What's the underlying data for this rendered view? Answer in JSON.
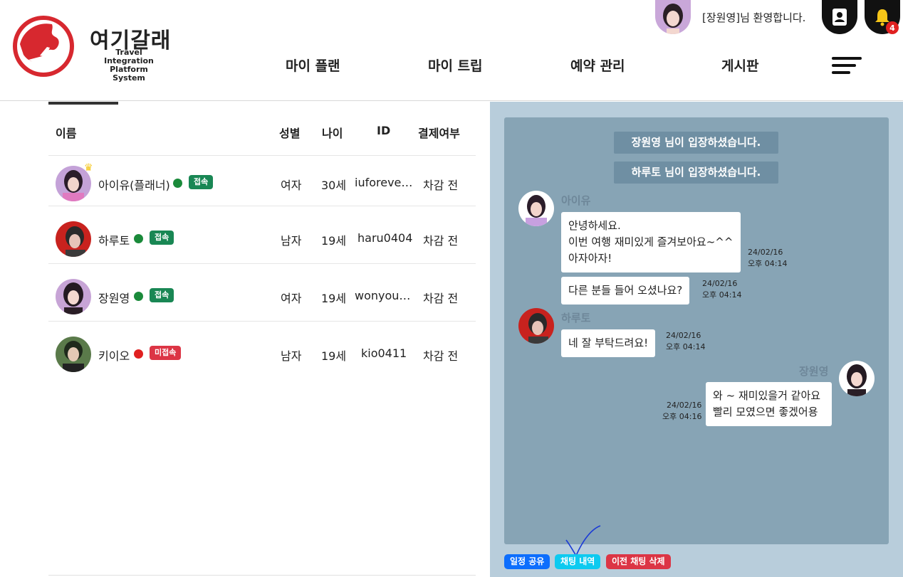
{
  "header": {
    "brand_name": "여기갈래",
    "brand_subtitle_line1": "Travel Integration",
    "brand_subtitle_line2": "Platform System",
    "welcome_text": "[장원영]님 환영합니다.",
    "notification_count": "4",
    "nav": [
      "마이 플랜",
      "마이 트립",
      "예약 관리",
      "게시판"
    ]
  },
  "table": {
    "headers": {
      "name": "이름",
      "gender": "성별",
      "age": "나이",
      "id": "ID",
      "payment": "결제여부"
    },
    "rows": [
      {
        "name": "아이유(플래너)",
        "status": "접속",
        "gender": "여자",
        "age": "30세",
        "id": "iuforeve…",
        "payment": "차감 전"
      },
      {
        "name": "하루토",
        "status": "접속",
        "gender": "남자",
        "age": "19세",
        "id": "haru0404",
        "payment": "차감 전"
      },
      {
        "name": "장원영",
        "status": "접속",
        "gender": "여자",
        "age": "19세",
        "id": "wonyou…",
        "payment": "차감 전"
      },
      {
        "name": "키이오",
        "status": "미접속",
        "gender": "남자",
        "age": "19세",
        "id": "kio0411",
        "payment": "차감 전"
      }
    ]
  },
  "chat": {
    "system_messages": [
      "장원영 님이 입장하셨습니다.",
      "하루토 님이 입장하셨습니다."
    ],
    "messages": [
      {
        "sender": "아이유",
        "lines": [
          "안녕하세요.",
          "이번 여행 재미있게 즐겨보아요~^^",
          "아자아자!"
        ],
        "date": "24/02/16",
        "time": "오후 04:14"
      },
      {
        "sender": "",
        "lines": [
          "다른 분들 들어 오셨나요?"
        ],
        "date": "24/02/16",
        "time": "오후 04:14"
      },
      {
        "sender": "하루토",
        "lines": [
          "네 잘 부탁드려요!"
        ],
        "date": "24/02/16",
        "time": "오후 04:14"
      },
      {
        "sender": "장원영",
        "lines": [
          "와 ~ 재미있을거 같아요",
          "빨리 모였으면 좋겠어용"
        ],
        "date": "24/02/16",
        "time": "오후 04:16"
      }
    ],
    "actions": {
      "share": "일정 공유",
      "history": "채팅 내역",
      "delete": "이전 채팅 삭제"
    }
  },
  "colors": {
    "brand_red": "#d7282f",
    "online": "#1a8a3a",
    "offline": "#e02020",
    "badge_online": "#198754",
    "badge_offline": "#dc3545",
    "btn_share": "#0d6efd",
    "btn_history": "#0dcaf0",
    "btn_delete": "#dc3545",
    "chat_panel": "#b8cddb",
    "chat_box": "#87a4b5"
  }
}
